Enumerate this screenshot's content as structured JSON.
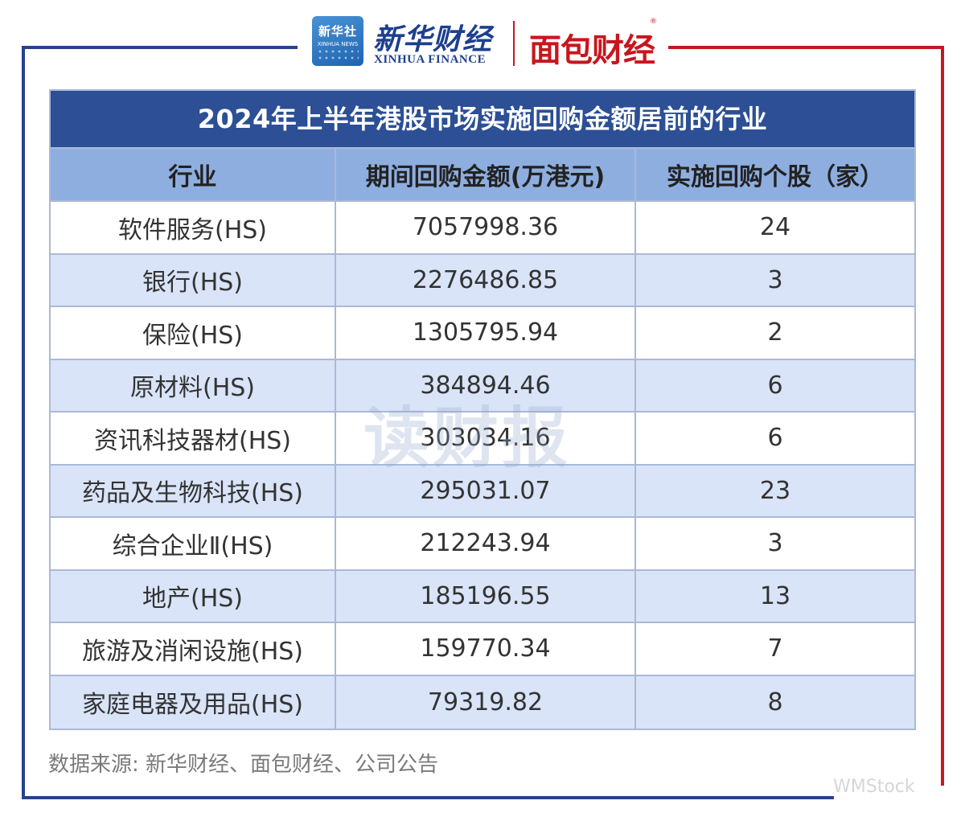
{
  "header": {
    "xinhua_badge_cn": "新华社",
    "xinhua_badge_en": "XINHUA NEWS",
    "xinhua_finance_cn": "新华财经",
    "xinhua_finance_en": "XINHUA FINANCE",
    "mianbao_cn": "面包财经",
    "registered_mark": "®"
  },
  "table": {
    "title": "2024年上半年港股市场实施回购金额居前的行业",
    "columns": [
      "行业",
      "期间回购金额(万港元)",
      "实施回购个股（家）"
    ],
    "rows": [
      [
        "软件服务(HS)",
        "7057998.36",
        "24"
      ],
      [
        "银行(HS)",
        "2276486.85",
        "3"
      ],
      [
        "保险(HS)",
        "1305795.94",
        "2"
      ],
      [
        "原材料(HS)",
        "384894.46",
        "6"
      ],
      [
        "资讯科技器材(HS)",
        "303034.16",
        "6"
      ],
      [
        "药品及生物科技(HS)",
        "295031.07",
        "23"
      ],
      [
        "综合企业Ⅱ(HS)",
        "212243.94",
        "3"
      ],
      [
        "地产(HS)",
        "185196.55",
        "13"
      ],
      [
        "旅游及消闲设施(HS)",
        "159770.34",
        "7"
      ],
      [
        "家庭电器及用品(HS)",
        "79319.82",
        "8"
      ]
    ]
  },
  "source": "数据来源: 新华财经、面包财经、公司公告",
  "watermark": "读财报",
  "corner_mark": "WMStock",
  "colors": {
    "frame_blue": "#27418f",
    "frame_red": "#c8161e",
    "title_bg": "#2c4f95",
    "header_bg": "#8eaee0",
    "stripe_bg": "#d9e4f8"
  }
}
